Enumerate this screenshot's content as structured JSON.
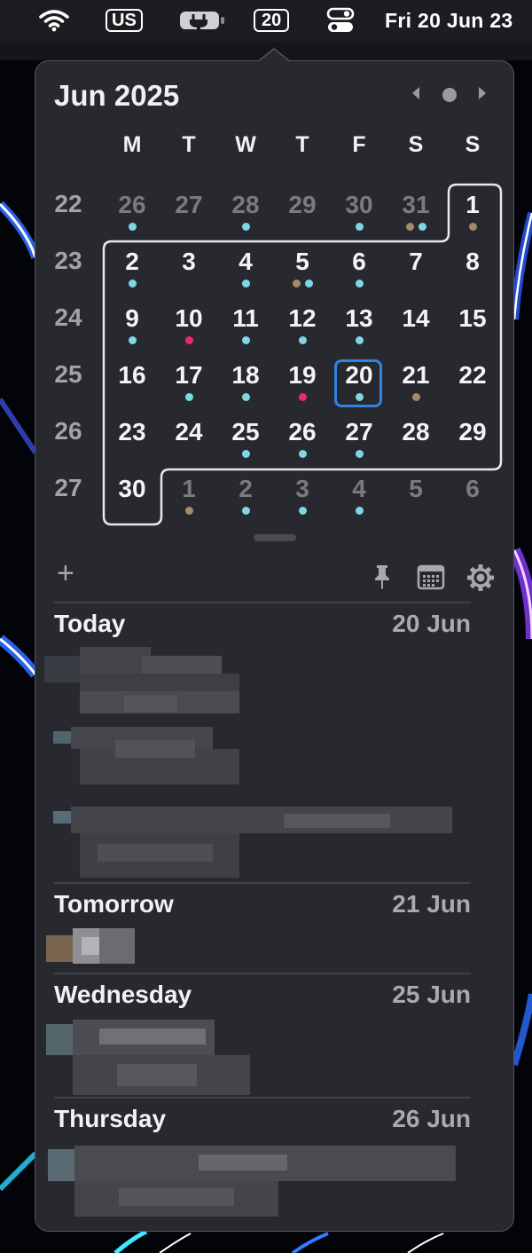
{
  "menubar": {
    "keyboard_layout": "US",
    "calendar_day": "20",
    "clock": "Fri 20 Jun  23",
    "icons": [
      "wifi-icon",
      "battery-charging-icon",
      "control-center-icon"
    ]
  },
  "calendar": {
    "title": "Jun 2025",
    "weekdays": [
      "M",
      "T",
      "W",
      "T",
      "F",
      "S",
      "S"
    ],
    "weeks": [
      {
        "num": "22",
        "days": [
          {
            "d": "26",
            "o": true,
            "dots": [
              "#7fd7e5"
            ]
          },
          {
            "d": "27",
            "o": true,
            "dots": []
          },
          {
            "d": "28",
            "o": true,
            "dots": [
              "#7fd7e5"
            ]
          },
          {
            "d": "29",
            "o": true,
            "dots": []
          },
          {
            "d": "30",
            "o": true,
            "dots": [
              "#7fd7e5"
            ]
          },
          {
            "d": "31",
            "o": true,
            "dots": [
              "#a38a6c",
              "#7fd7e5"
            ]
          },
          {
            "d": "1",
            "o": false,
            "dots": [
              "#a38a6c"
            ]
          }
        ]
      },
      {
        "num": "23",
        "days": [
          {
            "d": "2",
            "o": false,
            "dots": [
              "#7fd7e5"
            ]
          },
          {
            "d": "3",
            "o": false,
            "dots": []
          },
          {
            "d": "4",
            "o": false,
            "dots": [
              "#7fd7e5"
            ]
          },
          {
            "d": "5",
            "o": false,
            "dots": [
              "#a38a6c",
              "#7fd7e5"
            ]
          },
          {
            "d": "6",
            "o": false,
            "dots": [
              "#7fd7e5"
            ]
          },
          {
            "d": "7",
            "o": false,
            "dots": []
          },
          {
            "d": "8",
            "o": false,
            "dots": []
          }
        ]
      },
      {
        "num": "24",
        "days": [
          {
            "d": "9",
            "o": false,
            "dots": [
              "#7fd7e5"
            ]
          },
          {
            "d": "10",
            "o": false,
            "dots": [
              "#ee2a66"
            ]
          },
          {
            "d": "11",
            "o": false,
            "dots": [
              "#7fd7e5"
            ]
          },
          {
            "d": "12",
            "o": false,
            "dots": [
              "#7fd7e5"
            ]
          },
          {
            "d": "13",
            "o": false,
            "dots": [
              "#7fd7e5"
            ]
          },
          {
            "d": "14",
            "o": false,
            "dots": []
          },
          {
            "d": "15",
            "o": false,
            "dots": []
          }
        ]
      },
      {
        "num": "25",
        "days": [
          {
            "d": "16",
            "o": false,
            "dots": []
          },
          {
            "d": "17",
            "o": false,
            "dots": [
              "#7fd7e5"
            ]
          },
          {
            "d": "18",
            "o": false,
            "dots": [
              "#7fd7e5"
            ]
          },
          {
            "d": "19",
            "o": false,
            "dots": [
              "#ee2a66"
            ]
          },
          {
            "d": "20",
            "o": false,
            "dots": [
              "#7fd7e5"
            ]
          },
          {
            "d": "21",
            "o": false,
            "dots": [
              "#a38a6c"
            ]
          },
          {
            "d": "22",
            "o": false,
            "dots": []
          }
        ]
      },
      {
        "num": "26",
        "days": [
          {
            "d": "23",
            "o": false,
            "dots": []
          },
          {
            "d": "24",
            "o": false,
            "dots": []
          },
          {
            "d": "25",
            "o": false,
            "dots": [
              "#7fd7e5"
            ]
          },
          {
            "d": "26",
            "o": false,
            "dots": [
              "#7fd7e5"
            ]
          },
          {
            "d": "27",
            "o": false,
            "dots": [
              "#7fd7e5"
            ]
          },
          {
            "d": "28",
            "o": false,
            "dots": []
          },
          {
            "d": "29",
            "o": false,
            "dots": []
          }
        ]
      },
      {
        "num": "27",
        "days": [
          {
            "d": "30",
            "o": false,
            "dots": []
          },
          {
            "d": "1",
            "o": true,
            "dots": [
              "#a38a6c"
            ]
          },
          {
            "d": "2",
            "o": true,
            "dots": [
              "#7fd7e5"
            ]
          },
          {
            "d": "3",
            "o": true,
            "dots": [
              "#7fd7e5"
            ]
          },
          {
            "d": "4",
            "o": true,
            "dots": [
              "#7fd7e5"
            ]
          },
          {
            "d": "5",
            "o": true,
            "dots": []
          },
          {
            "d": "6",
            "o": true,
            "dots": []
          }
        ]
      }
    ],
    "today": "20"
  },
  "toolbar": {
    "add_label": "+",
    "icons": [
      "pin-icon",
      "calendar-grid-icon",
      "gear-icon"
    ]
  },
  "agenda": [
    {
      "title": "Today",
      "date": "20 Jun"
    },
    {
      "title": "Tomorrow",
      "date": "21 Jun"
    },
    {
      "title": "Wednesday",
      "date": "25 Jun"
    },
    {
      "title": "Thursday",
      "date": "26 Jun"
    }
  ],
  "colors": {
    "accent": "#2f84e6",
    "event_cyan": "#7fd7e5",
    "event_brown": "#a38a6c",
    "event_red": "#ee2a66",
    "popover_bg": "#28292e"
  }
}
